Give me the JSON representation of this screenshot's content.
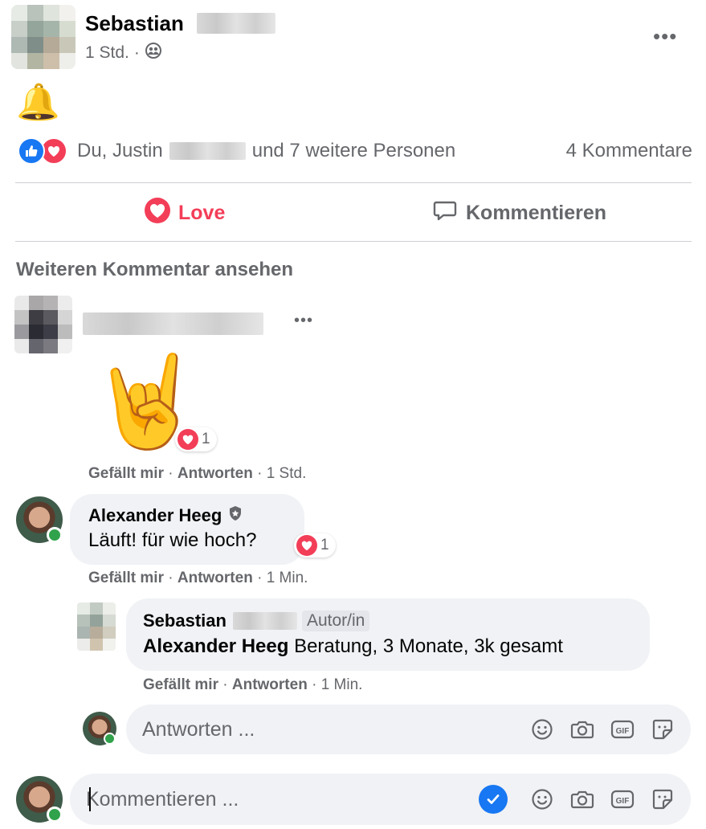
{
  "post": {
    "author_first": "Sebastian",
    "time": "1 Std.",
    "dot": "·",
    "visibility_icon": "friends-icon",
    "content_emoji": "🔔",
    "reactions_text_a": "Du, Justin",
    "reactions_text_b": "und 7 weitere Personen",
    "comments_count": "4 Kommentare"
  },
  "actions": {
    "love_label": "Love",
    "comment_label": "Kommentieren",
    "love_color": "#f33e58"
  },
  "more_comments": "Weiteren Kommentar ansehen",
  "comment1": {
    "emoji": "🤘",
    "reaction_count": "1",
    "like": "Gefällt mir",
    "reply": "Antworten",
    "time": "1 Std.",
    "sep": "·"
  },
  "comment2": {
    "name": "Alexander Heeg",
    "text": "Läuft! für wie hoch?",
    "reaction_count": "1",
    "like": "Gefällt mir",
    "reply": "Antworten",
    "time": "1 Min.",
    "sep": "·"
  },
  "reply1": {
    "name": "Sebastian",
    "badge": "Autor/in",
    "mention": "Alexander Heeg",
    "text": " Beratung, 3 Monate, 3k gesamt",
    "like": "Gefällt mir",
    "reply": "Antworten",
    "time": "1 Min.",
    "sep": "·"
  },
  "reply_input": {
    "placeholder": "Antworten ..."
  },
  "comment_input": {
    "placeholder": "Kommentieren ..."
  },
  "colors": {
    "accent_blue": "#1877f2",
    "love_red": "#f33e58",
    "secondary_text": "#65676b"
  }
}
